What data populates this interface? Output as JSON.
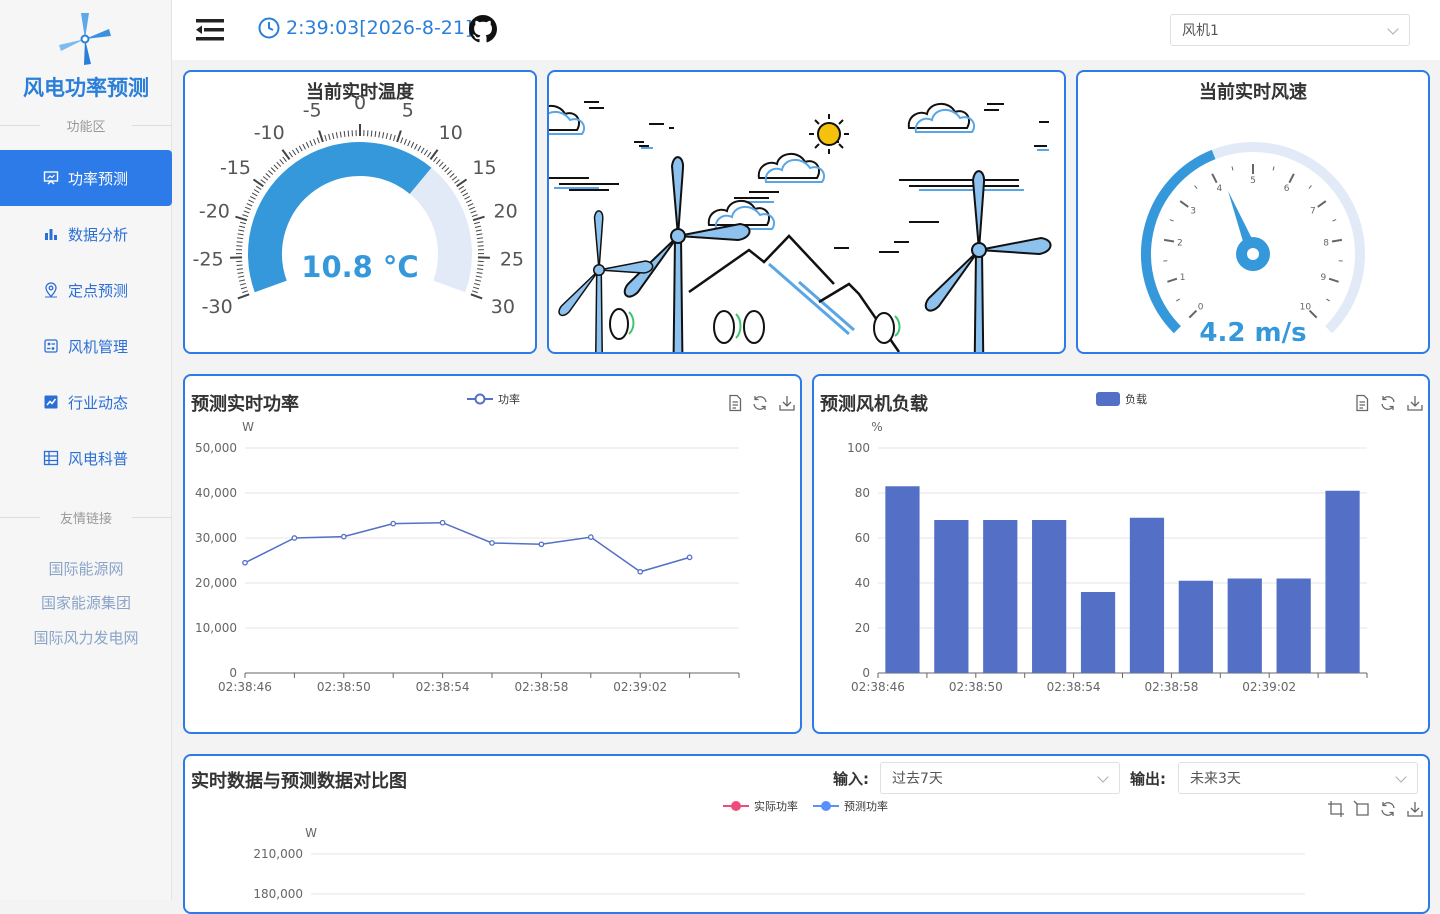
{
  "app": {
    "title": "风电功率预测"
  },
  "sidebar": {
    "section_label": "功能区",
    "items": [
      {
        "label": "功率预测",
        "icon": "presentation-icon",
        "active": true
      },
      {
        "label": "数据分析",
        "icon": "bar-chart-icon",
        "active": false
      },
      {
        "label": "定点预测",
        "icon": "location-pin-icon",
        "active": false
      },
      {
        "label": "风机管理",
        "icon": "settings-list-icon",
        "active": false
      },
      {
        "label": "行业动态",
        "icon": "trend-icon",
        "active": false
      },
      {
        "label": "风电科普",
        "icon": "grid-icon",
        "active": false
      }
    ],
    "links_label": "友情链接",
    "links": [
      "国际能源网",
      "国家能源集团",
      "国际风力发电网"
    ]
  },
  "header": {
    "time": "2:39:03[2026-8-21]",
    "turbine_select": "风机1"
  },
  "temperature": {
    "title": "当前实时温度",
    "value": 10.8,
    "display": "10.8 °C",
    "min": -30,
    "max": 30,
    "ticks": [
      "-30",
      "-25",
      "-20",
      "-15",
      "-10",
      "-5",
      "0",
      "5",
      "10",
      "15",
      "20",
      "25",
      "30"
    ]
  },
  "wind": {
    "title": "当前实时风速",
    "value": 4.2,
    "display": "4.2 m/s",
    "min": 0,
    "max": 10,
    "ticks": [
      "0",
      "1",
      "2",
      "3",
      "4",
      "5",
      "6",
      "7",
      "8",
      "9",
      "10"
    ]
  },
  "colors": {
    "accent": "#2d7be8",
    "gauge": "#3498db",
    "gauge_track": "#e3eaf7",
    "bar": "#5470c6",
    "line": "#5470c6",
    "actual": "#ee4d7b",
    "predicted": "#5b8ff9"
  },
  "power_chart": {
    "title": "预测实时功率",
    "legend": "功率",
    "unit": "W",
    "toolbar": [
      "data-view-icon",
      "restore-icon",
      "save-image-icon"
    ]
  },
  "load_chart": {
    "title": "预测风机负载",
    "legend": "负载",
    "unit": "%",
    "toolbar": [
      "data-view-icon",
      "restore-icon",
      "save-image-icon"
    ]
  },
  "compare_chart": {
    "title": "实时数据与预测数据对比图",
    "input_label": "输入:",
    "input_value": "过去7天",
    "output_label": "输出:",
    "output_value": "未来3天",
    "legend": [
      "实际功率",
      "预测功率"
    ],
    "unit": "W",
    "visible_ticks": [
      "210,000",
      "180,000"
    ]
  },
  "chart_data": [
    {
      "type": "line",
      "title": "预测实时功率",
      "ylabel": "W",
      "x": [
        "02:38:46",
        "02:38:48",
        "02:38:50",
        "02:38:52",
        "02:38:54",
        "02:38:56",
        "02:38:58",
        "02:39:00",
        "02:39:02",
        "02:39:04"
      ],
      "x_tick_labels": [
        "02:38:46",
        "02:38:50",
        "02:38:54",
        "02:38:58",
        "02:39:02"
      ],
      "y_tick_labels": [
        "0",
        "10,000",
        "20,000",
        "30,000",
        "40,000",
        "50,000"
      ],
      "series": [
        {
          "name": "功率",
          "values": [
            24500,
            30000,
            30300,
            33200,
            33400,
            28900,
            28600,
            30200,
            22500,
            25700
          ]
        }
      ],
      "ylim": [
        0,
        50000
      ],
      "grid": true,
      "legend": "top-center"
    },
    {
      "type": "bar",
      "title": "预测风机负载",
      "ylabel": "%",
      "categories": [
        "02:38:46",
        "02:38:48",
        "02:38:50",
        "02:38:52",
        "02:38:54",
        "02:38:56",
        "02:38:58",
        "02:39:00",
        "02:39:02",
        "02:39:04"
      ],
      "x_tick_labels": [
        "02:38:46",
        "02:38:50",
        "02:38:54",
        "02:38:58",
        "02:39:02"
      ],
      "y_tick_labels": [
        "0",
        "20",
        "40",
        "60",
        "80",
        "100"
      ],
      "series": [
        {
          "name": "负载",
          "values": [
            83,
            68,
            68,
            68,
            36,
            69,
            41,
            42,
            42,
            81
          ]
        }
      ],
      "ylim": [
        0,
        100
      ],
      "grid": true,
      "legend": "top-center"
    }
  ]
}
